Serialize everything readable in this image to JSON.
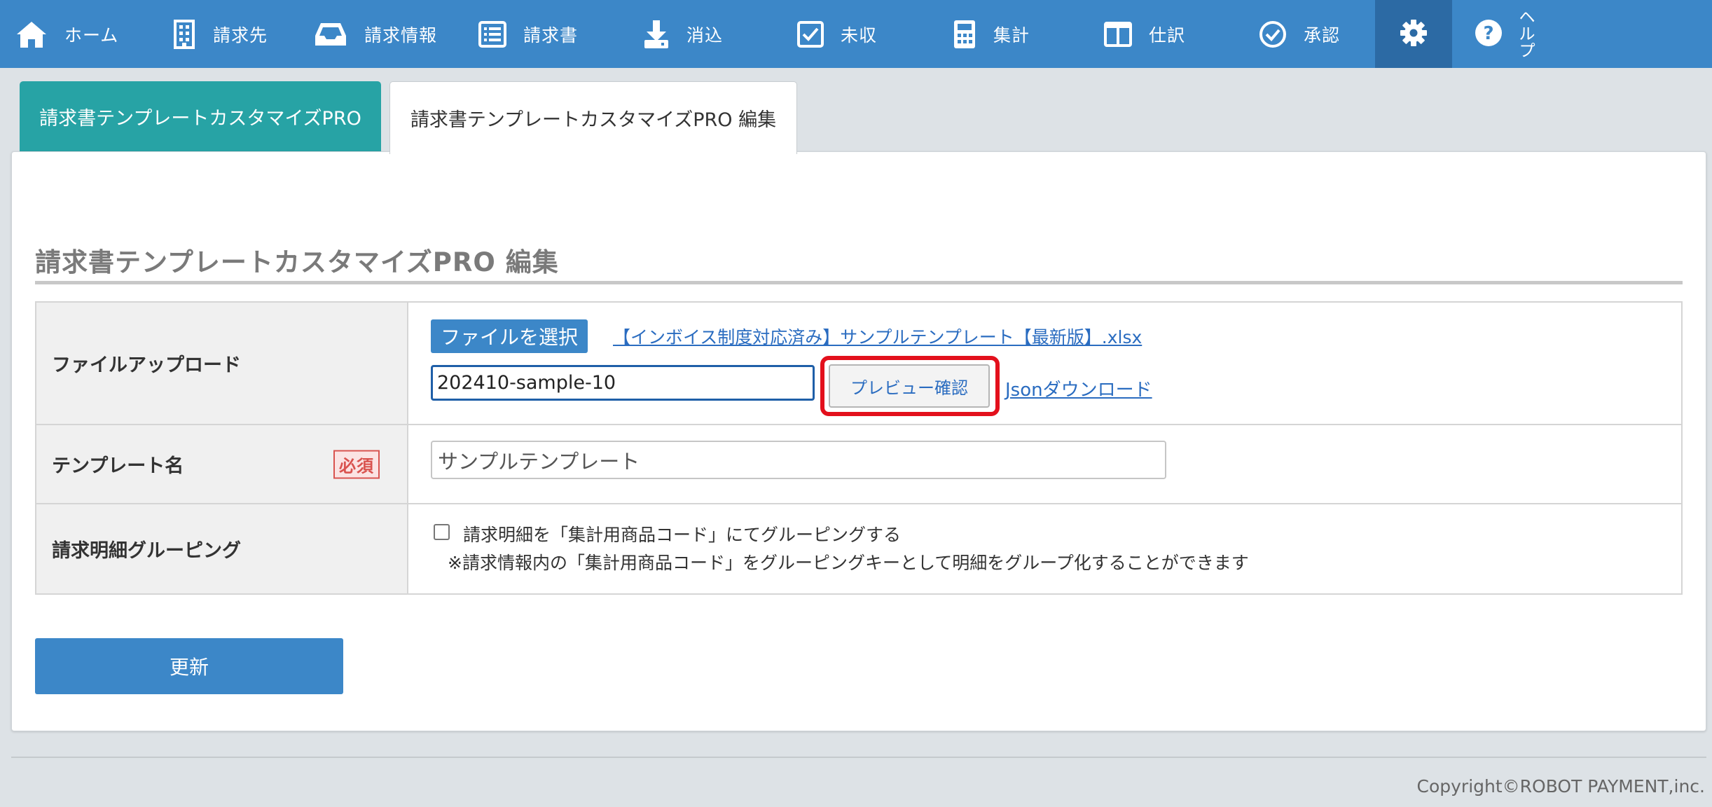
{
  "nav": {
    "items": [
      {
        "label": "ホーム",
        "icon": "home-icon"
      },
      {
        "label": "請求先",
        "icon": "building-icon"
      },
      {
        "label": "請求情報",
        "icon": "inbox-tray-icon"
      },
      {
        "label": "請求書",
        "icon": "list-icon"
      },
      {
        "label": "消込",
        "icon": "download-arrow-icon"
      },
      {
        "label": "未収",
        "icon": "checkbox-icon"
      },
      {
        "label": "集計",
        "icon": "calculator-icon"
      },
      {
        "label": "仕訳",
        "icon": "columns-book-icon"
      },
      {
        "label": "承認",
        "icon": "check-circle-icon"
      }
    ],
    "settings_icon": "gear-icon",
    "help": {
      "icon": "question-circle-icon",
      "chars": [
        "ヘ",
        "ル",
        "プ"
      ]
    }
  },
  "tabs": [
    {
      "label": "請求書テンプレートカスタマイズPRO"
    },
    {
      "label": "請求書テンプレートカスタマイズPRO 編集"
    }
  ],
  "page": {
    "title": "請求書テンプレートカスタマイズPRO 編集"
  },
  "form": {
    "upload": {
      "label": "ファイルアップロード",
      "choose_button": "ファイルを選択",
      "sample_link": "【インボイス制度対応済み】サンプルテンプレート【最新版】.xlsx",
      "filename_value": "202410-sample-10",
      "preview_button": "プレビュー確認",
      "json_link": "Jsonダウンロード"
    },
    "template_name": {
      "label": "テンプレート名",
      "required_badge": "必須",
      "value": "サンプルテンプレート"
    },
    "grouping": {
      "label": "請求明細グルーピング",
      "checkbox_label": "請求明細を「集計用商品コード」にてグルーピングする",
      "note": "※請求情報内の「集計用商品コード」をグルーピングキーとして明細をグループ化することができます"
    },
    "update_button": "更新"
  },
  "footer": {
    "copyright": "Copyright©ROBOT PAYMENT,inc."
  },
  "colors": {
    "nav_bg": "#3c87c8",
    "nav_active_bg": "#2c6aa4",
    "tab_active_bg": "#27a3a5",
    "link": "#2a6cc0",
    "highlight": "#e3101c",
    "required": "#d9534f"
  }
}
